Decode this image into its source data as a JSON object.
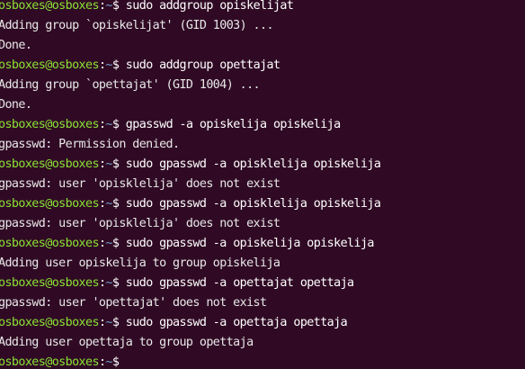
{
  "terminal": {
    "colors": {
      "background": "#300a24",
      "prompt_user": "#8ae234",
      "prompt_path": "#729fcf",
      "text": "#e8e8e8"
    },
    "lines": [
      {
        "type": "prompt",
        "user": "osboxes@osboxes",
        "sep": ":",
        "path": "~",
        "dollar": "$",
        "cmd": " sudo addgroup opiskelijat"
      },
      {
        "type": "output",
        "text": "Adding group `opiskelijat' (GID 1003) ..."
      },
      {
        "type": "output",
        "text": "Done."
      },
      {
        "type": "prompt",
        "user": "osboxes@osboxes",
        "sep": ":",
        "path": "~",
        "dollar": "$",
        "cmd": " sudo addgroup opettajat"
      },
      {
        "type": "output",
        "text": "Adding group `opettajat' (GID 1004) ..."
      },
      {
        "type": "output",
        "text": "Done."
      },
      {
        "type": "prompt",
        "user": "osboxes@osboxes",
        "sep": ":",
        "path": "~",
        "dollar": "$",
        "cmd": " gpasswd -a opiskelija opiskelija"
      },
      {
        "type": "output",
        "text": "gpasswd: Permission denied."
      },
      {
        "type": "prompt",
        "user": "osboxes@osboxes",
        "sep": ":",
        "path": "~",
        "dollar": "$",
        "cmd": " sudo gpasswd -a opisklelija opiskelija"
      },
      {
        "type": "output",
        "text": "gpasswd: user 'opisklelija' does not exist"
      },
      {
        "type": "prompt",
        "user": "osboxes@osboxes",
        "sep": ":",
        "path": "~",
        "dollar": "$",
        "cmd": " sudo gpasswd -a opisklelija opiskelija"
      },
      {
        "type": "output",
        "text": "gpasswd: user 'opisklelija' does not exist"
      },
      {
        "type": "prompt",
        "user": "osboxes@osboxes",
        "sep": ":",
        "path": "~",
        "dollar": "$",
        "cmd": " sudo gpasswd -a opiskelija opiskelija"
      },
      {
        "type": "output",
        "text": "Adding user opiskelija to group opiskelija"
      },
      {
        "type": "prompt",
        "user": "osboxes@osboxes",
        "sep": ":",
        "path": "~",
        "dollar": "$",
        "cmd": " sudo gpasswd -a opettajat opettaja"
      },
      {
        "type": "output",
        "text": "gpasswd: user 'opettajat' does not exist"
      },
      {
        "type": "prompt",
        "user": "osboxes@osboxes",
        "sep": ":",
        "path": "~",
        "dollar": "$",
        "cmd": " sudo gpasswd -a opettaja opettaja"
      },
      {
        "type": "output",
        "text": "Adding user opettaja to group opettaja"
      },
      {
        "type": "prompt",
        "user": "osboxes@osboxes",
        "sep": ":",
        "path": "~",
        "dollar": "$",
        "cmd": ""
      }
    ]
  }
}
